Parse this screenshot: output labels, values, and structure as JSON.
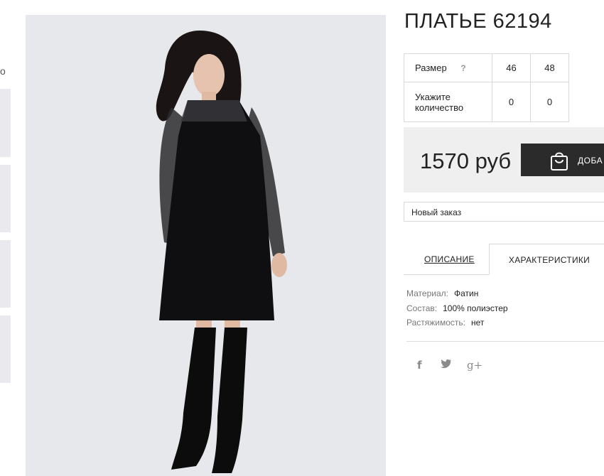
{
  "thumbnails": {
    "partial_letter": "o"
  },
  "product": {
    "title": "ПЛАТЬЕ 62194",
    "size_label": "Размер",
    "size_help_icon": "question-icon",
    "help_glyph": "?",
    "sizes": [
      "46",
      "48"
    ],
    "qty_label_line1": "Укажите",
    "qty_label_line2": "количество",
    "quantities": [
      "0",
      "0"
    ],
    "price": "1570 руб",
    "add_to_cart_label": "ДОБА",
    "order_select_value": "Новый заказ"
  },
  "tabs": {
    "description": "ОПИСАНИЕ",
    "characteristics": "ХАРАКТЕРИСТИКИ"
  },
  "characteristics": [
    {
      "key": "Материал:",
      "value": "Фатин"
    },
    {
      "key": "Состав:",
      "value": "100% полиэстер"
    },
    {
      "key": "Растяжимость:",
      "value": "нет"
    }
  ],
  "social": [
    {
      "icon": "facebook-icon",
      "glyph": "f"
    },
    {
      "icon": "twitter-icon",
      "glyph": "🐦"
    },
    {
      "icon": "google-plus-icon",
      "glyph": "g+"
    }
  ],
  "colors": {
    "button_bg": "#2b2b2b",
    "price_bg": "#efefef",
    "photo_bg": "#e7e8ec"
  }
}
